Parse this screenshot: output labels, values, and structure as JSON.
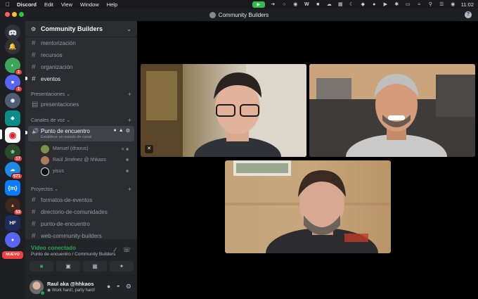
{
  "menubar": {
    "app": "Discord",
    "items": [
      "Edit",
      "View",
      "Window",
      "Help"
    ],
    "clock": "11:02"
  },
  "window": {
    "title": "Community Builders"
  },
  "rail": {
    "badges": {
      "server_2": "1",
      "server_3": "1",
      "server_7": "17",
      "server_8": "571",
      "server_10": "53"
    },
    "matrix_label": "{m}",
    "hf_label": "HF",
    "new_label": "NUEVO"
  },
  "sidebar": {
    "server_name": "Community Builders",
    "channels_top": [
      "mentorización",
      "recursos",
      "organización",
      "eventos"
    ],
    "category_presentaciones": "Presentaciones",
    "channel_presentaciones": "presentaciones",
    "category_voz": "Canales de voz",
    "voice_channel": {
      "name": "Punto de encuentro",
      "status": "Establece un estado de canal"
    },
    "voice_users": [
      {
        "name": "Manuel (draxus)"
      },
      {
        "name": "Raúl Jiménez @ hhkaos"
      },
      {
        "name": "yisus"
      }
    ],
    "category_proyectos": "Proyectos",
    "channels_proyectos": [
      "formatos-de-eventos",
      "directorio-de-comunidades",
      "punto-de-encuentro",
      "web-community-builders"
    ]
  },
  "voice_panel": {
    "title": "Vídeo conectado",
    "subtitle": "Punto de encuentro / Community Builders"
  },
  "user_panel": {
    "name": "Raul aka @hhkaos",
    "status": "Work hard!, party hard!"
  }
}
